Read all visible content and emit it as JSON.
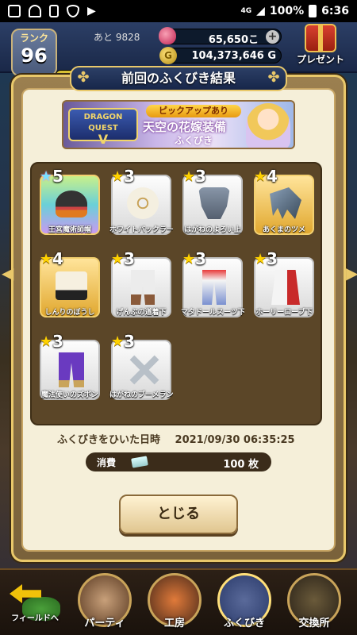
{
  "status": {
    "network": "4G",
    "battery": "100%",
    "time": "6:36"
  },
  "hud": {
    "rank_label": "ランク",
    "rank_value": "96",
    "exp_remaining": "あと 9828",
    "exp_progress": 0.2,
    "gems": "65,650こ",
    "gold": "104,373,646 G",
    "gold_symbol": "G",
    "present_label": "プレゼント"
  },
  "panel": {
    "title": "前回のふくびき結果",
    "banner": {
      "logo_line1": "DRAGON QUEST",
      "logo_line2": "V",
      "tag": "ピックアップあり",
      "title": "天空の花嫁装備",
      "subtitle": "ふくびき"
    },
    "items": [
      {
        "stars": "5",
        "name": "王宮魔術師帽",
        "rarity": "r5"
      },
      {
        "stars": "3",
        "name": "ホワイトバックラー",
        "rarity": "r3"
      },
      {
        "stars": "3",
        "name": "はがねのよろい上",
        "rarity": "r3"
      },
      {
        "stars": "4",
        "name": "あくまのツメ",
        "rarity": "r4"
      },
      {
        "stars": "4",
        "name": "しんりのぼうし",
        "rarity": "r4"
      },
      {
        "stars": "3",
        "name": "げんぶの道着下",
        "rarity": "r3"
      },
      {
        "stars": "3",
        "name": "マタドールスーツ下",
        "rarity": "r3"
      },
      {
        "stars": "3",
        "name": "ホーリーローブ下",
        "rarity": "r3"
      },
      {
        "stars": "3",
        "name": "魔法使いのズボン",
        "rarity": "r3"
      },
      {
        "stars": "3",
        "name": "はがねのブーメラン",
        "rarity": "r3"
      }
    ],
    "date_label": "ふくびきをひいた日時",
    "date_value": "2021/09/30 06:35:25",
    "consume_label": "消費",
    "consume_value": "100 枚",
    "close_label": "とじる"
  },
  "nav": {
    "field": "フィールドへ",
    "party": "パーティ",
    "workshop": "工房",
    "lottery": "ふくびき",
    "exchange": "交換所"
  }
}
